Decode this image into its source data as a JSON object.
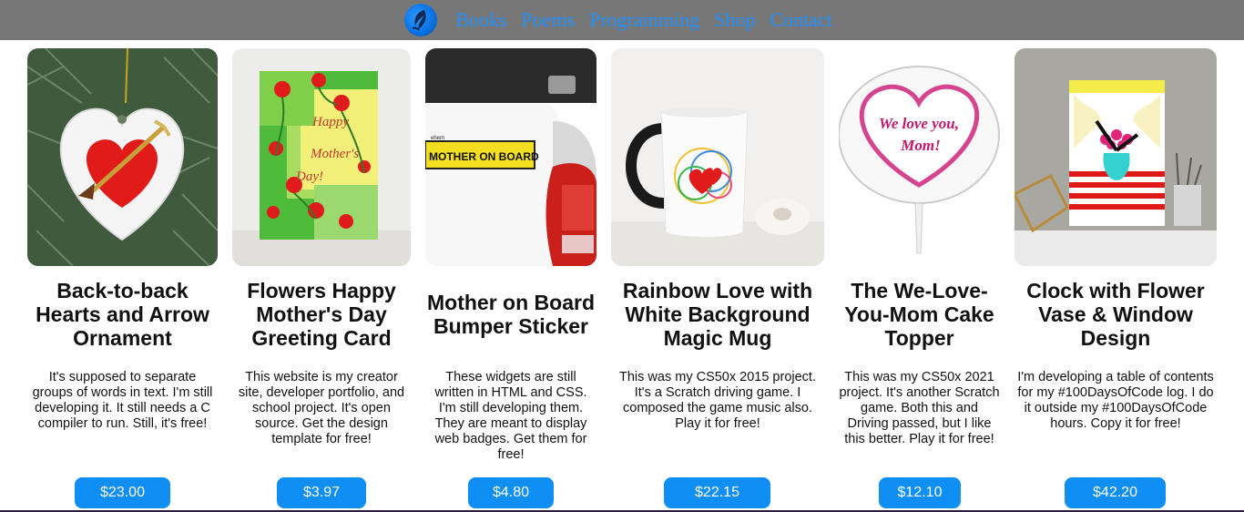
{
  "nav": {
    "logo_icon": "quill-logo-icon",
    "links": [
      "Books",
      "Poems",
      "Programming",
      "Shop",
      "Contact"
    ]
  },
  "colors": {
    "nav_bg": "#777777",
    "link": "#1e90ff",
    "price_button": "#0f8ff3"
  },
  "products": [
    {
      "title": "Back-to-back Hearts and Arrow Ornament",
      "description": "It's supposed to separate groups of words in text. I'm still developing it. It still needs a C compiler to run. Still, it's free!",
      "price": "$23.00"
    },
    {
      "title": "Flowers Happy Mother's Day Greeting Card",
      "description": "This website is my creator site, developer portfolio, and school project. It's open source. Get the design template for free!",
      "price": "$3.97",
      "image_text": "Happy Mother's Day!"
    },
    {
      "title": "Mother on Board Bumper Sticker",
      "description": "These widgets are still written in HTML and CSS. I'm still developing them. They are meant to display web badges. Get them for free!",
      "price": "$4.80",
      "image_text": "MOTHER ON BOARD"
    },
    {
      "title": "Rainbow Love with White Background Magic Mug",
      "description": "This was my CS50x 2015 project. It's a Scratch driving game. I composed the game music also. Play it for free!",
      "price": "$22.15"
    },
    {
      "title": "The We-Love-You-Mom Cake Topper",
      "description": "This was my CS50x 2021 project. It's another Scratch game. Both this and Driving passed, but I like this better. Play it for free!",
      "price": "$12.10",
      "image_text": "We love you, Mom!"
    },
    {
      "title": "Clock with Flower Vase & Window Design",
      "description": "I'm developing a table of contents for my #100DaysOfCode log. I do it outside my #100DaysOfCode hours. Copy it for free!",
      "price": "$42.20"
    }
  ]
}
